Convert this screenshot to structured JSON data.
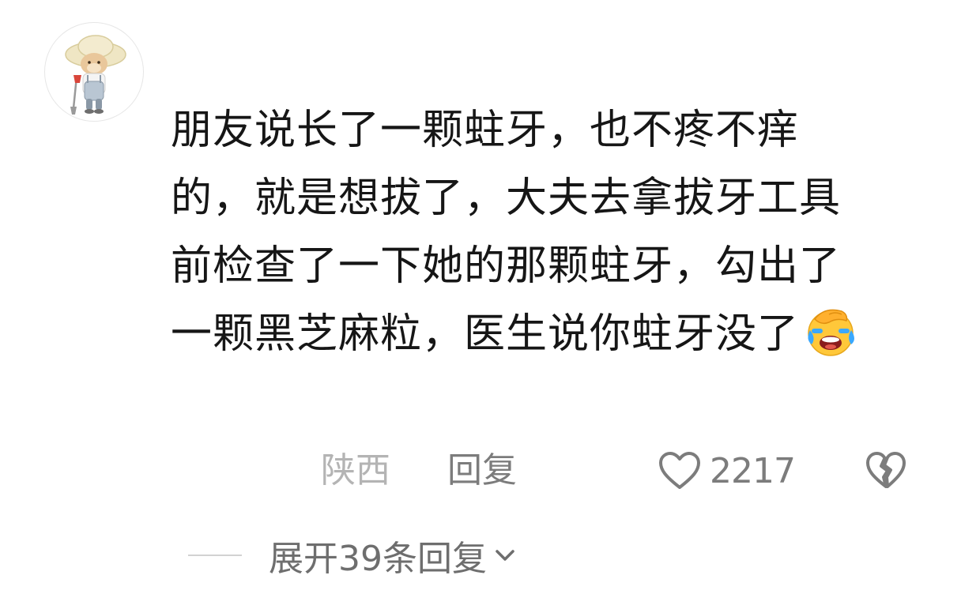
{
  "comment": {
    "text": "朋友说长了一颗蛀牙，也不疼不痒的，就是想拔了，大夫去拿拔牙工具前检查了一下她的那颗蛀牙，勾出了一颗黑芝麻粒，医生说你蛀牙没了",
    "emoji": "face-palm-crying-emoji"
  },
  "meta": {
    "location": "陕西",
    "reply_label": "回复",
    "like_count": "2217",
    "like_icon": "heart-outline-icon",
    "dislike_icon": "broken-heart-icon"
  },
  "replies": {
    "expand_label": "展开39条回复",
    "expand_icon": "chevron-down-icon"
  },
  "colors": {
    "text": "#161616",
    "muted": "#7c7c7c",
    "location": "#b4b4b4"
  }
}
